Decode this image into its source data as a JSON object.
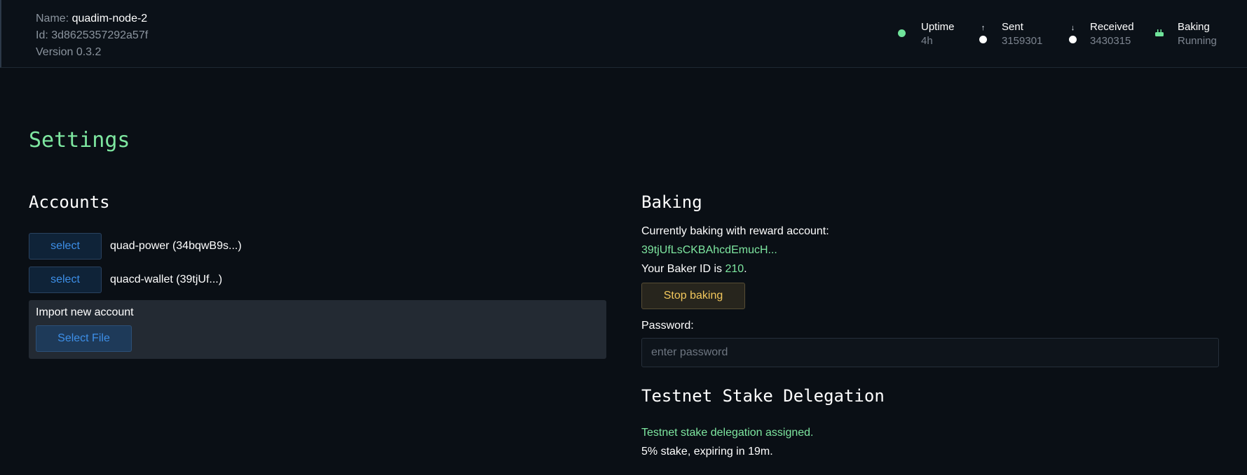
{
  "header": {
    "name_label": "Name:",
    "name_value": "quadim-node-2",
    "id_text": "Id: 3d8625357292a57f",
    "version_text": "Version 0.3.2",
    "stats": [
      {
        "label": "Uptime",
        "value": "4h",
        "icon": "status-dot-icon",
        "color": "#6fe39a"
      },
      {
        "label": "Sent",
        "value": "3159301",
        "icon": "upload-arrow-icon",
        "color": "#ffffff"
      },
      {
        "label": "Received",
        "value": "3430315",
        "icon": "download-arrow-icon",
        "color": "#ffffff"
      },
      {
        "label": "Baking",
        "value": "Running",
        "icon": "cake-icon",
        "color": "#6fe39a"
      }
    ]
  },
  "page": {
    "title": "Settings"
  },
  "accounts": {
    "title": "Accounts",
    "items": [
      {
        "button_label": "select",
        "label": "quad-power (34bqwB9s...)"
      },
      {
        "button_label": "select",
        "label": "quacd-wallet (39tjUf...)"
      }
    ],
    "import": {
      "label": "Import new account",
      "button_label": "Select File"
    }
  },
  "baking": {
    "title": "Baking",
    "reward_text": "Currently baking with reward account:",
    "reward_account": "39tjUfLsCKBAhcdEmucH...",
    "baker_id_prefix": "Your Baker ID is",
    "baker_id": "210",
    "baker_id_suffix": ".",
    "stop_button_label": "Stop baking",
    "password_label": "Password:",
    "password_placeholder": "enter password"
  },
  "delegation": {
    "title": "Testnet Stake Delegation",
    "status": "Testnet stake delegation assigned.",
    "detail": "5% stake, expiring in 19m."
  },
  "colors": {
    "accent_green": "#7ee7a0",
    "link_blue": "#3d8fe8",
    "warning_yellow": "#f2c75c"
  }
}
